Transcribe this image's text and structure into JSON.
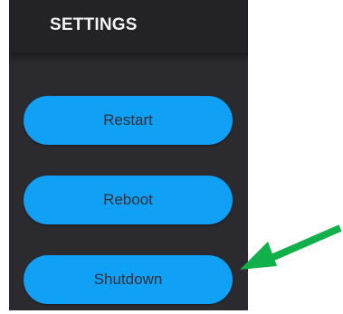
{
  "header": {
    "title": "SETTINGS"
  },
  "buttons": {
    "restart": "Restart",
    "reboot": "Reboot",
    "shutdown": "Shutdown"
  },
  "colors": {
    "panel": "#2b2a2e",
    "header": "#232227",
    "button": "#10a0f5",
    "button_text": "#2f3136",
    "arrow": "#12b04a"
  },
  "annotation": {
    "icon": "green-arrow-icon",
    "points_to": "shutdown"
  }
}
